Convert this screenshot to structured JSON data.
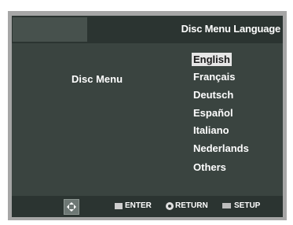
{
  "header": {
    "title": "Disc Menu Language"
  },
  "menu": {
    "label": "Disc Menu"
  },
  "languages": [
    {
      "label": "English",
      "selected": true
    },
    {
      "label": "Français",
      "selected": false
    },
    {
      "label": "Deutsch",
      "selected": false
    },
    {
      "label": "Español",
      "selected": false
    },
    {
      "label": "Italiano",
      "selected": false
    },
    {
      "label": "Nederlands",
      "selected": false
    },
    {
      "label": "Others",
      "selected": false
    }
  ],
  "footer": {
    "navigate_icon": "dpad-icon",
    "enter_label": "ENTER",
    "return_label": "RETURN",
    "setup_label": "SETUP"
  },
  "colors": {
    "screen_bg": "#3a4440",
    "bar_bg": "#2b3431",
    "highlight": "#e6e6e6",
    "frame": "#a6a6a6"
  }
}
